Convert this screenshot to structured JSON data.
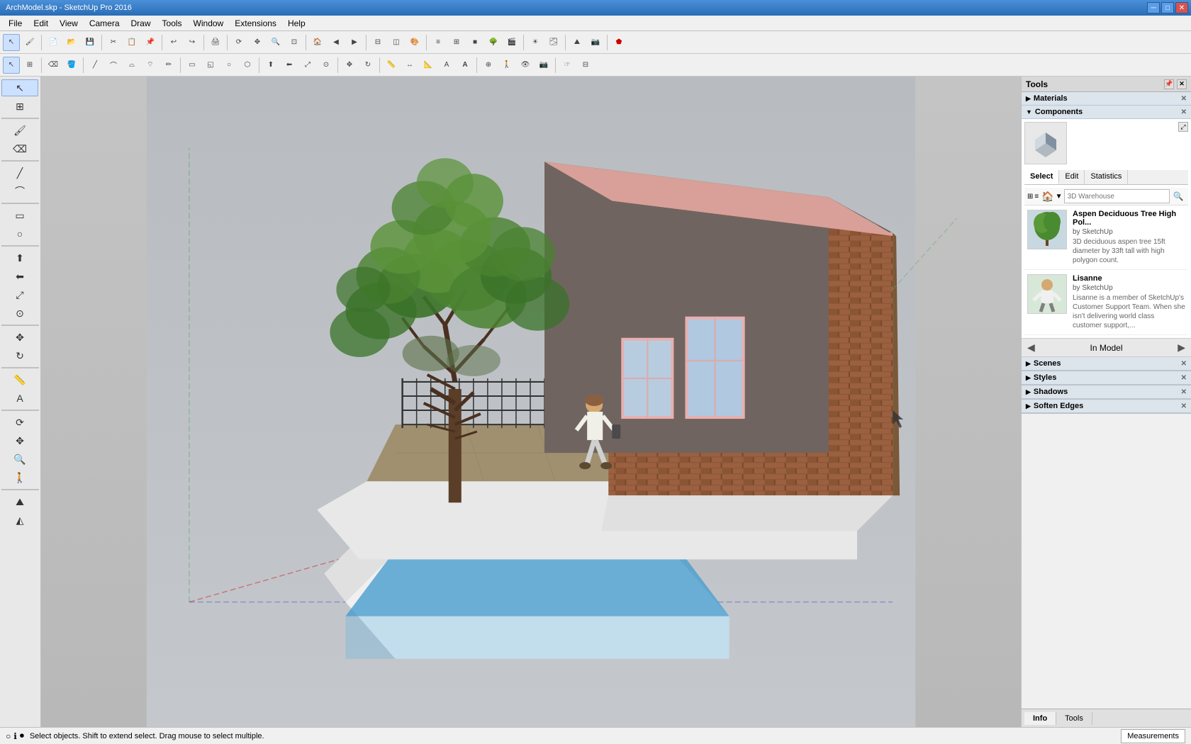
{
  "titlebar": {
    "title": "ArchModel.skp - SketchUp Pro 2016",
    "min_btn": "─",
    "max_btn": "□",
    "close_btn": "✕"
  },
  "menubar": {
    "items": [
      "File",
      "Edit",
      "View",
      "Camera",
      "Draw",
      "Tools",
      "Window",
      "Extensions",
      "Help"
    ]
  },
  "toolbar1": {
    "buttons": [
      "↖",
      "□",
      "⊞",
      "💾",
      "📁",
      "🖨",
      "✂",
      "📋",
      "↩",
      "↪",
      "⊙",
      "⊕",
      "⊙",
      "🏠",
      "□",
      "△",
      "▭",
      "◀",
      "▶",
      "🔧"
    ]
  },
  "toolbar2": {
    "buttons": [
      "↖",
      "✥",
      "⟺",
      "⟸",
      "↗",
      "↩",
      "↪",
      "⊙",
      "⊕",
      "□",
      "△",
      "○",
      "◇",
      "⌗",
      "⊠",
      "⊡",
      "△",
      "△",
      "○",
      "◯",
      "⬡",
      "⬣",
      "○",
      "◯",
      "⊸",
      "⊿",
      "⊕",
      "⊖",
      "⊞",
      "⊟",
      "🏠",
      "🔄",
      "🔃",
      "📐",
      "📏"
    ]
  },
  "tools_panel": {
    "title": "Tools"
  },
  "materials": {
    "label": "Materials"
  },
  "components": {
    "label": "Components",
    "preview_icon": "◻",
    "tabs": [
      {
        "label": "Select",
        "active": true
      },
      {
        "label": "Edit",
        "active": false
      },
      {
        "label": "Statistics",
        "active": false
      }
    ],
    "warehouse_label": "3D Warehouse",
    "warehouse_placeholder": "3D Warehouse",
    "search_icon": "🔍",
    "items": [
      {
        "name": "Aspen Deciduous Tree High Pol...",
        "author": "by SketchUp",
        "desc": "3D deciduous aspen tree 15ft diameter by 33ft tall with high polygon count."
      },
      {
        "name": "Lisanne",
        "author": "by SketchUp",
        "desc": "Lisanne is a member of SketchUp's Customer Support Team. When she isn't delivering world class customer support,..."
      }
    ]
  },
  "in_model": {
    "label": "In Model",
    "arrow_left": "◀",
    "arrow_right": "▶"
  },
  "lower_panels": [
    {
      "label": "Scenes",
      "collapsed": false
    },
    {
      "label": "Styles",
      "collapsed": false
    },
    {
      "label": "Shadows",
      "collapsed": false
    },
    {
      "label": "Soften Edges",
      "collapsed": false
    }
  ],
  "bottom_tabs": [
    {
      "label": "Info",
      "active": true
    },
    {
      "label": "Tools",
      "active": false
    }
  ],
  "statusbar": {
    "icons": [
      "○",
      "ℹ",
      "⏺"
    ],
    "text": "Select objects. Shift to extend select. Drag mouse to select multiple.",
    "measurements_label": "Measurements"
  },
  "scene": {
    "background": "#c4c4c4"
  }
}
